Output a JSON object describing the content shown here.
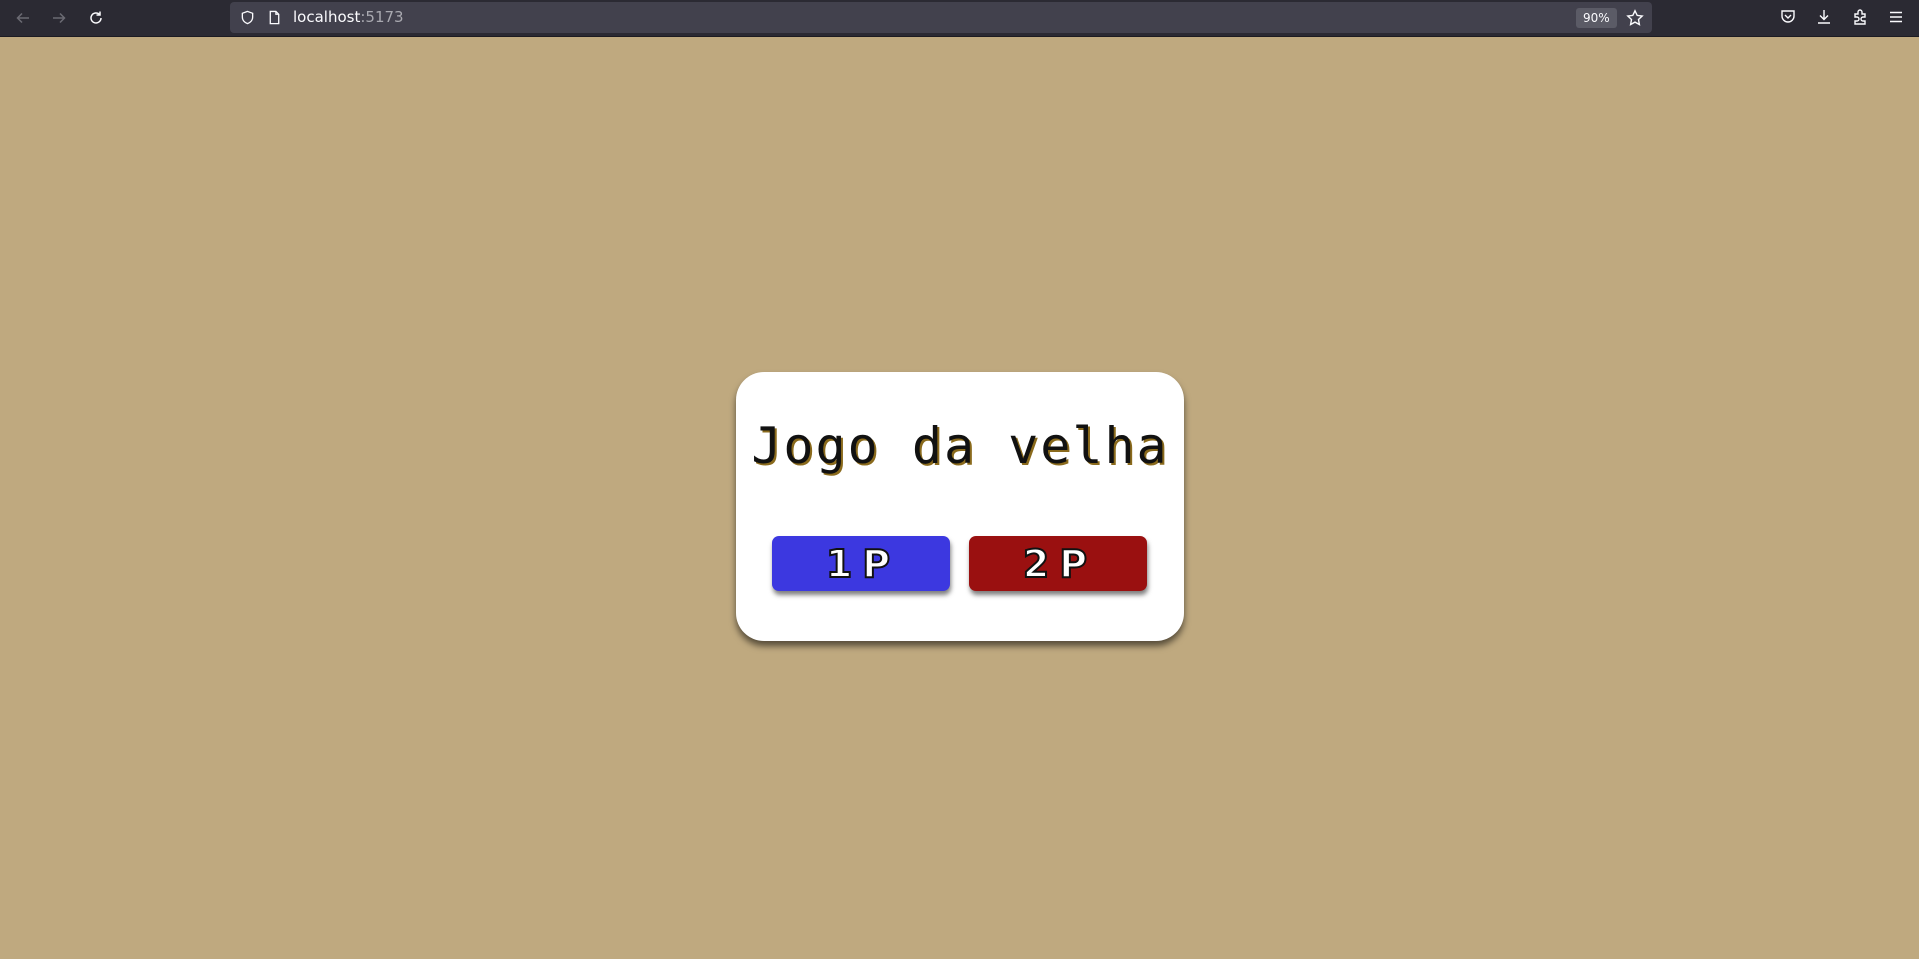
{
  "browser": {
    "url_host": "localhost",
    "url_port": ":5173",
    "zoom": "90%",
    "icons": {
      "back": "back-arrow-icon",
      "forward": "forward-arrow-icon",
      "reload": "reload-icon",
      "shield": "shield-icon",
      "page": "page-icon",
      "bookmark": "star-icon",
      "pocket": "pocket-icon",
      "downloads": "download-icon",
      "extensions": "extensions-icon",
      "menu": "hamburger-menu-icon"
    }
  },
  "page": {
    "background_color": "#bfa97f",
    "title": "Jogo da velha",
    "buttons": {
      "one_player": {
        "label": "1P",
        "color": "#3c38e0"
      },
      "two_player": {
        "label": "2P",
        "color": "#9a1010"
      }
    }
  }
}
